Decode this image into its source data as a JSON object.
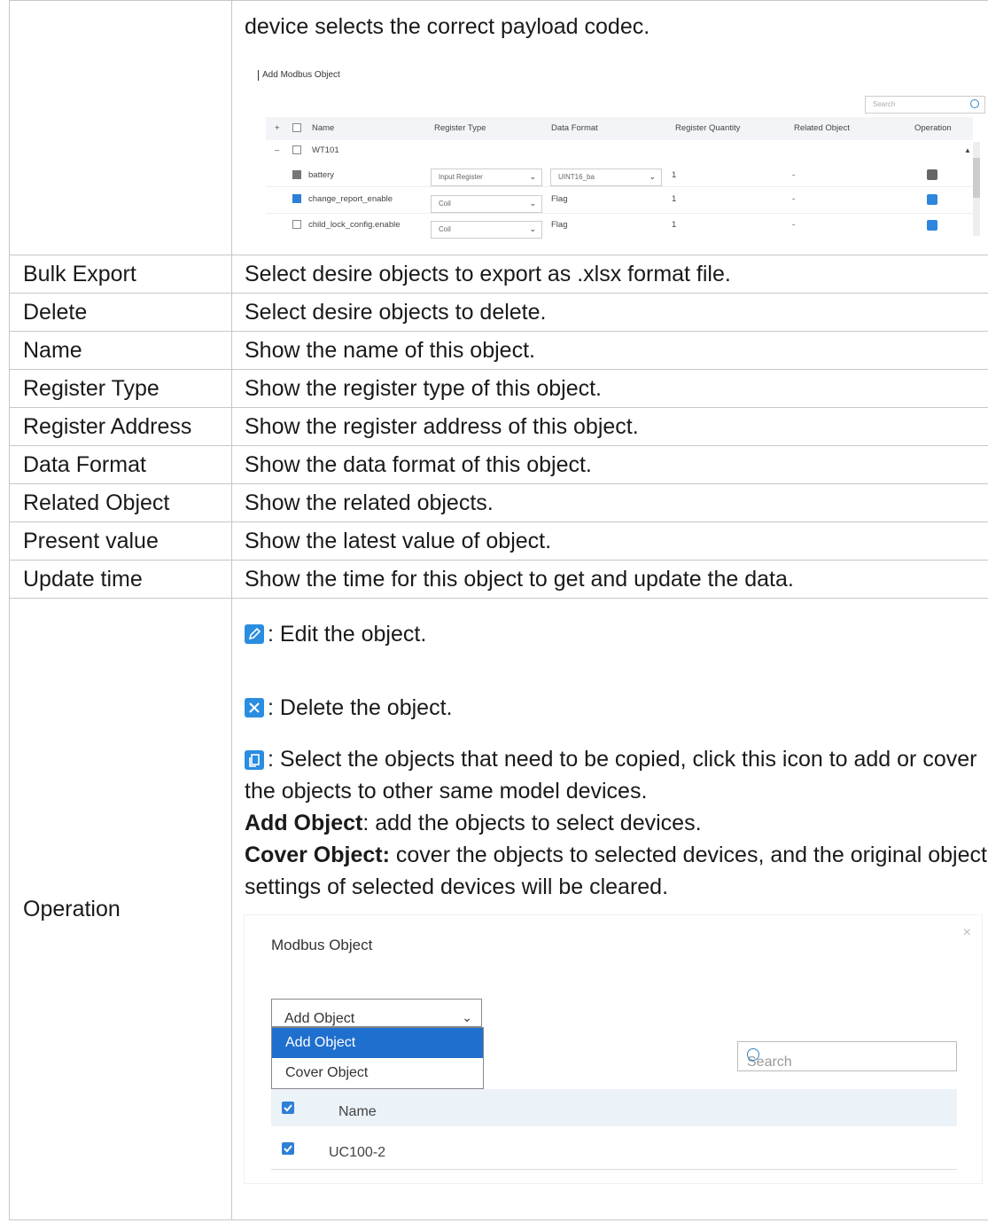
{
  "top_row": {
    "text": "device selects the correct payload codec."
  },
  "screenshot1": {
    "title": "Add Modbus Object",
    "search_placeholder": "Search",
    "columns": [
      "Name",
      "Register Type",
      "Data Format",
      "Register Quantity",
      "Related Object",
      "Operation"
    ],
    "group_row": "WT101",
    "rows": [
      {
        "name": "battery",
        "register_type": "Input Register",
        "data_format": "UINT16_ba",
        "quantity": "1",
        "related": "-"
      },
      {
        "name": "change_report_enable",
        "register_type": "Coil",
        "data_format": "Flag",
        "quantity": "1",
        "related": "-"
      },
      {
        "name": "child_lock_config.enable",
        "register_type": "Coil",
        "data_format": "Flag",
        "quantity": "1",
        "related": "-"
      }
    ]
  },
  "rows": [
    {
      "label": "Bulk Export",
      "desc": "Select desire objects to export as .xlsx format file."
    },
    {
      "label": "Delete",
      "desc": "Select desire objects to delete."
    },
    {
      "label": "Name",
      "desc": "Show the name of this object."
    },
    {
      "label": "Register Type",
      "desc": "Show the register type of this object."
    },
    {
      "label": "Register Address",
      "desc": "Show the register address of this object."
    },
    {
      "label": "Data Format",
      "desc": "Show the data format of this object."
    },
    {
      "label": "Related Object",
      "desc": "Show the related objects."
    },
    {
      "label": "Present value",
      "desc": "Show the latest value of object."
    },
    {
      "label": "Update time",
      "desc": "Show the time for this object to get and update the data."
    }
  ],
  "operation": {
    "label": "Operation",
    "edit_text": ": Edit the object.",
    "delete_text": ": Delete the object.",
    "copy_text": ": Select the objects that need to be copied, click this icon to add or cover the objects to other same model devices.",
    "add_bold": "Add Object",
    "add_text": ": add the objects to select devices.",
    "cover_bold": "Cover Object:",
    "cover_text": " cover the objects to selected devices, and the original object settings of selected devices will be cleared.",
    "icon_colors": {
      "edit": "#2a8de0",
      "delete": "#2a8de0",
      "copy": "#2a8de0"
    }
  },
  "screenshot2": {
    "title": "Modbus Object",
    "close_glyph": "×",
    "select_value": "Add Object",
    "options": [
      "Add Object",
      "Cover Object"
    ],
    "search_placeholder": "Search",
    "column_name": "Name",
    "device": "UC100-2",
    "accent": "#1f6fcf"
  }
}
